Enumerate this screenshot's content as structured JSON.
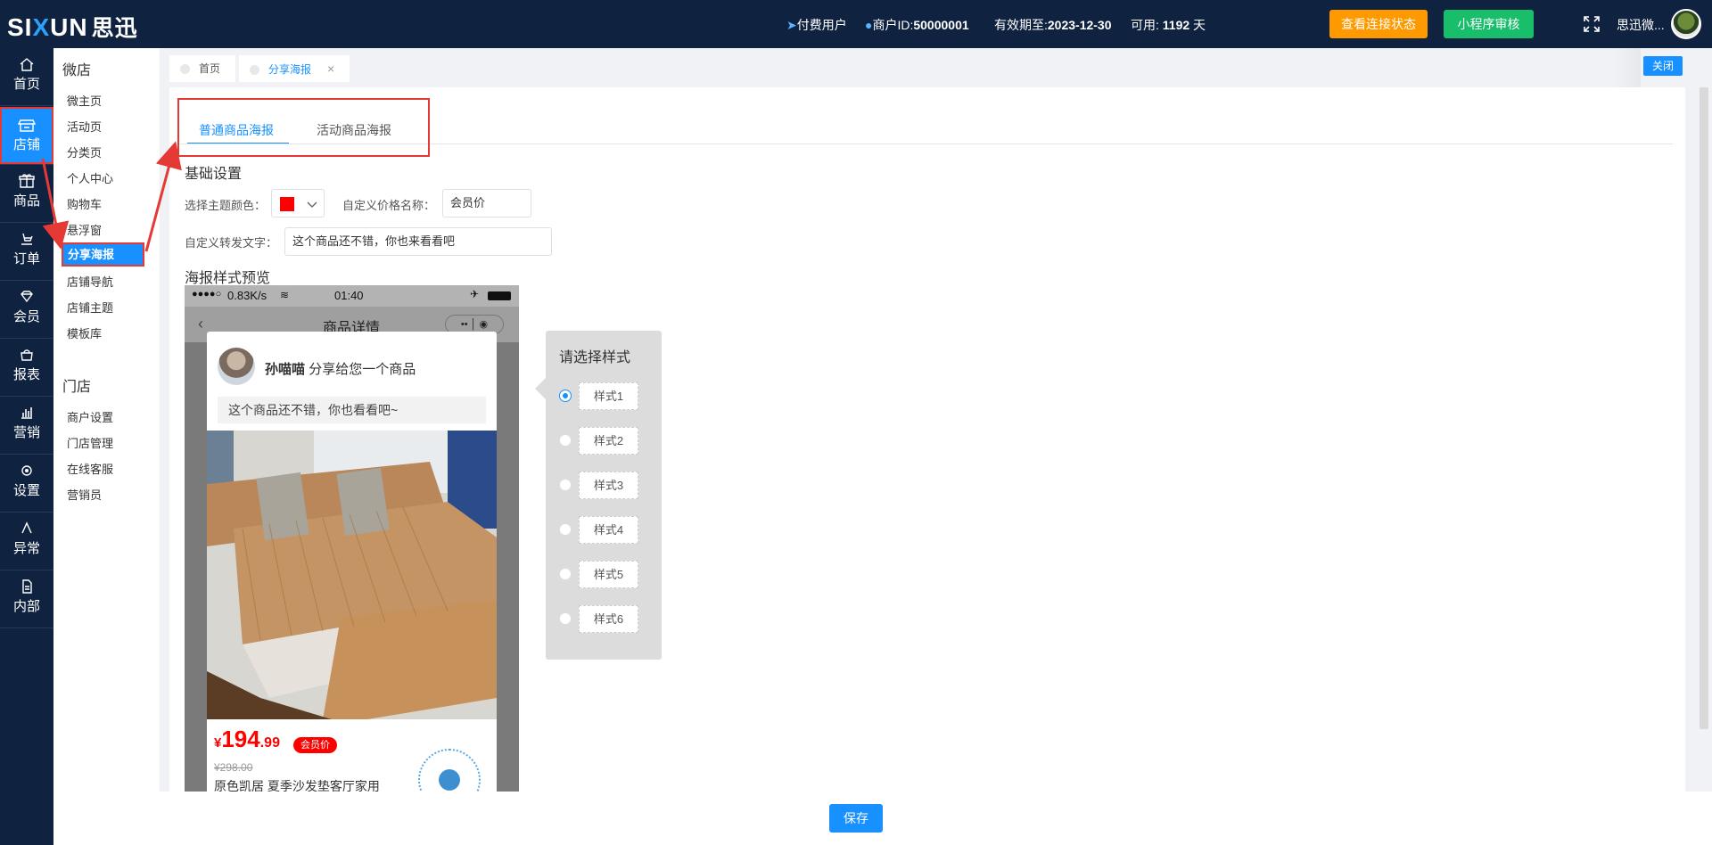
{
  "header": {
    "logo_text_a": "SI",
    "logo_text_x": "X",
    "logo_text_b": "UN",
    "logo_cn": "思迅",
    "paid_user": "付费用户",
    "merchant_label": "商户ID:",
    "merchant_id": "50000001",
    "expiry_label": "有效期至:",
    "expiry_date": "2023-12-30",
    "available_label": "可用:",
    "available_days": "1192",
    "days_unit": "天",
    "view_connection_btn": "查看连接状态",
    "mini_program_btn": "小程序审核",
    "user_name": "思迅微..."
  },
  "leftnav": [
    {
      "label": "首页",
      "icon": "home-icon"
    },
    {
      "label": "店铺",
      "icon": "store-icon"
    },
    {
      "label": "商品",
      "icon": "gift-icon"
    },
    {
      "label": "订单",
      "icon": "order-icon"
    },
    {
      "label": "会员",
      "icon": "diamond-icon"
    },
    {
      "label": "报表",
      "icon": "basket-icon"
    },
    {
      "label": "营销",
      "icon": "bar-chart-icon"
    },
    {
      "label": "设置",
      "icon": "gear-icon"
    },
    {
      "label": "异常",
      "icon": "warning-icon"
    },
    {
      "label": "内部",
      "icon": "file-icon"
    }
  ],
  "submenu": {
    "group1_title": "微店",
    "group1_items": [
      "微主页",
      "活动页",
      "分类页",
      "个人中心",
      "购物车",
      "悬浮窗",
      "分享海报",
      "店铺导航",
      "店铺主题",
      "模板库"
    ],
    "group2_title": "门店",
    "group2_items": [
      "商户设置",
      "门店管理",
      "在线客服",
      "营销员"
    ]
  },
  "tabs": {
    "home": "首页",
    "share_poster": "分享海报",
    "close_symbol": "×",
    "close_all": "关闭"
  },
  "content": {
    "tab_normal": "普通商品海报",
    "tab_activity": "活动商品海报",
    "basic_settings": "基础设置",
    "theme_color_label": "选择主题颜色：",
    "theme_color": "#ff0000",
    "price_name_label": "自定义价格名称：",
    "price_name_value": "会员价",
    "share_text_label": "自定义转发文字：",
    "share_text_value": "这个商品还不错，你也来看看吧",
    "preview_title": "海报样式预览"
  },
  "phone": {
    "signal": "●●●●○",
    "speed": "0.83K/s",
    "time": "01:40",
    "nav_title": "商品详情",
    "user_name": "孙喵喵",
    "share_msg": "分享给您一个商品",
    "bubble_text": "这个商品还不错，你也看看吧~",
    "price_currency": "¥",
    "price_int": "194",
    "price_dec": ".99",
    "member_badge": "会员价",
    "old_price": "¥298.00",
    "product_title": "原色凯居 夏季沙发垫客厅家用"
  },
  "chooser": {
    "title": "请选择样式",
    "selected": 0,
    "options": [
      "样式1",
      "样式2",
      "样式3",
      "样式4",
      "样式5",
      "样式6"
    ]
  },
  "footer": {
    "save": "保存"
  },
  "colors": {
    "topbar": "#0f2240",
    "primary": "#1890ff",
    "orange": "#ff9900",
    "green": "#19be6b",
    "highlight_red": "#e53935"
  }
}
